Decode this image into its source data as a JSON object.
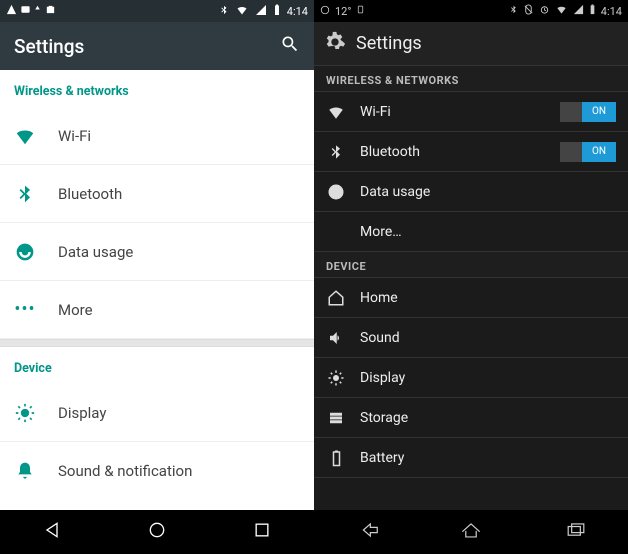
{
  "left": {
    "status": {
      "time": "4:14"
    },
    "title": "Settings",
    "section_wireless": "Wireless & networks",
    "items_wireless": [
      {
        "label": "Wi-Fi"
      },
      {
        "label": "Bluetooth"
      },
      {
        "label": "Data usage"
      },
      {
        "label": "More"
      }
    ],
    "section_device": "Device",
    "items_device": [
      {
        "label": "Display"
      },
      {
        "label": "Sound & notification"
      }
    ]
  },
  "right": {
    "status": {
      "temp": "12°",
      "time": "4:14"
    },
    "title": "Settings",
    "section_wireless": "WIRELESS & NETWORKS",
    "items_wireless": [
      {
        "label": "Wi-Fi",
        "toggle": "ON"
      },
      {
        "label": "Bluetooth",
        "toggle": "ON"
      },
      {
        "label": "Data usage"
      },
      {
        "label": "More…"
      }
    ],
    "section_device": "DEVICE",
    "items_device": [
      {
        "label": "Home"
      },
      {
        "label": "Sound"
      },
      {
        "label": "Display"
      },
      {
        "label": "Storage"
      },
      {
        "label": "Battery"
      }
    ]
  }
}
